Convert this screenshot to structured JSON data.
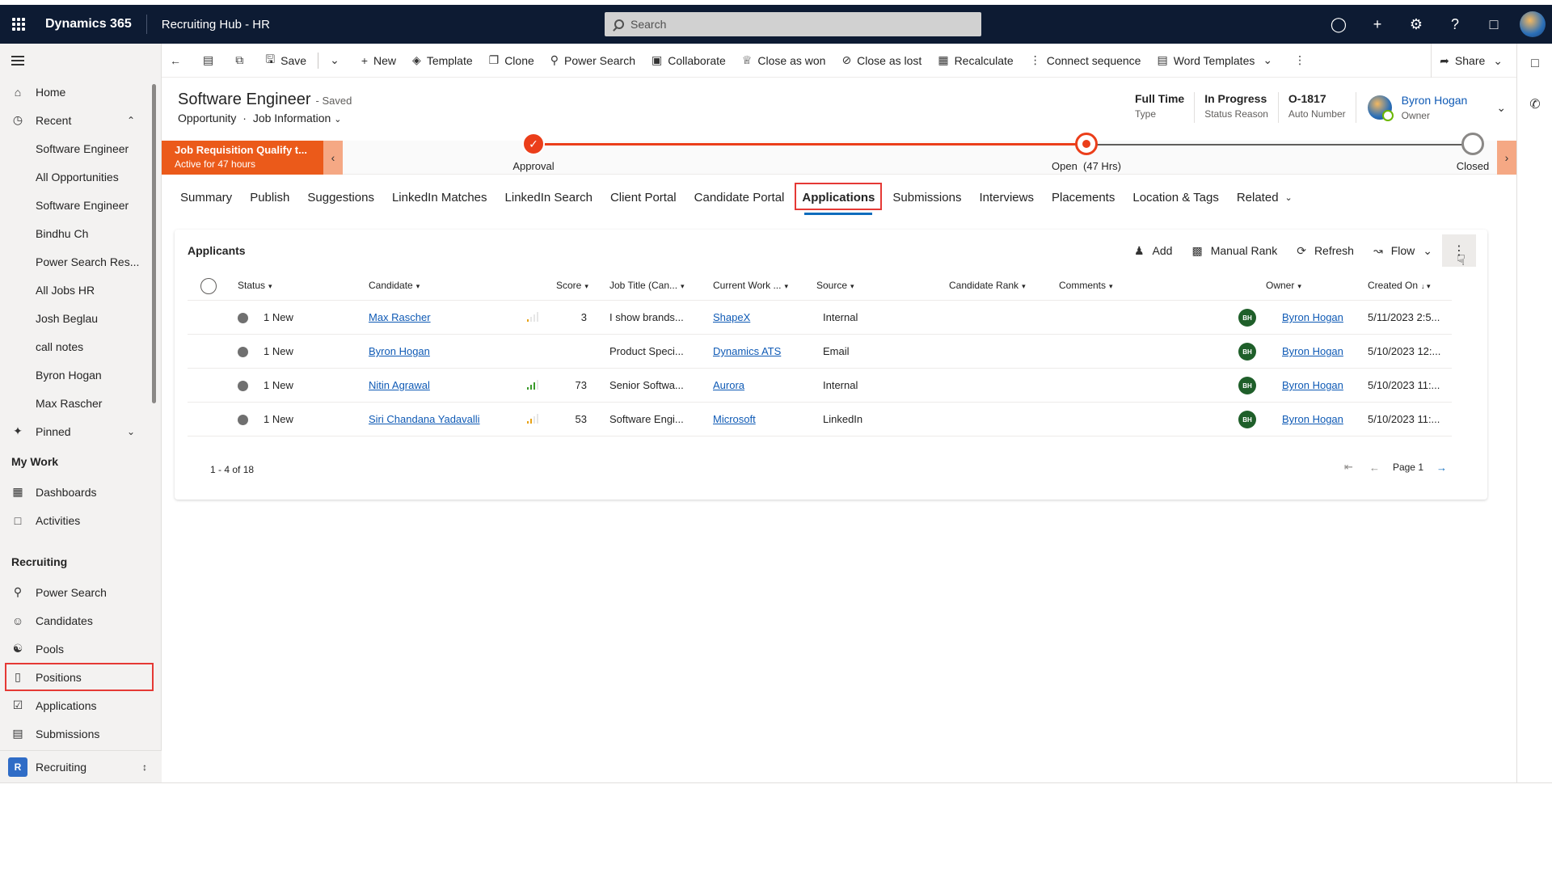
{
  "header": {
    "brand": "Dynamics 365",
    "app_name": "Recruiting Hub - HR",
    "search_placeholder": "Search",
    "icons": [
      "lightbulb-icon",
      "plus-icon",
      "gear-icon",
      "question-icon",
      "chat-icon",
      "avatar"
    ]
  },
  "nav": {
    "home": "Home",
    "recent": "Recent",
    "recent_items": [
      "Software Engineer",
      "All Opportunities",
      "Software Engineer",
      "Bindhu Ch",
      "Power Search Res...",
      "All Jobs HR",
      "Josh Beglau",
      "call notes",
      "Byron Hogan",
      "Max Rascher"
    ],
    "pinned": "Pinned",
    "my_work": "My Work",
    "dashboards": "Dashboards",
    "activities": "Activities",
    "recruiting": "Recruiting",
    "power_search": "Power Search",
    "candidates": "Candidates",
    "pools": "Pools",
    "positions": "Positions",
    "applications": "Applications",
    "submissions": "Submissions",
    "area_badge": "R",
    "area_name": "Recruiting"
  },
  "commands": {
    "save": "Save",
    "new": "New",
    "template": "Template",
    "clone": "Clone",
    "power_search": "Power Search",
    "collaborate": "Collaborate",
    "close_won": "Close as won",
    "close_lost": "Close as lost",
    "recalculate": "Recalculate",
    "connect_sequence": "Connect sequence",
    "word_templates": "Word Templates",
    "share": "Share"
  },
  "form": {
    "title": "Software Engineer",
    "saved": "- Saved",
    "entity": "Opportunity",
    "dot": "·",
    "form_name": "Job Information",
    "fields": [
      {
        "value": "Full Time",
        "label": "Type"
      },
      {
        "value": "In Progress",
        "label": "Status Reason"
      },
      {
        "value": "O-1817",
        "label": "Auto Number"
      }
    ],
    "owner_name": "Byron Hogan",
    "owner_label": "Owner"
  },
  "bpf": {
    "active_title": "Job Requisition Qualify t...",
    "active_sub": "Active for 47 hours",
    "stages": [
      "Approval",
      "Open  (47 Hrs)",
      "Closed"
    ]
  },
  "tabs": [
    "Summary",
    "Publish",
    "Suggestions",
    "LinkedIn Matches",
    "LinkedIn Search",
    "Client Portal",
    "Candidate Portal",
    "Applications",
    "Submissions",
    "Interviews",
    "Placements",
    "Location & Tags",
    "Related"
  ],
  "grid": {
    "title": "Applicants",
    "add": "Add",
    "manual_rank": "Manual Rank",
    "refresh": "Refresh",
    "flow": "Flow",
    "more": "⋮",
    "columns": {
      "status": "Status",
      "candidate": "Candidate",
      "score": "Score",
      "job_title": "Job Title (Can...",
      "current_work": "Current Work ...",
      "source": "Source",
      "candidate_rank": "Candidate Rank",
      "comments": "Comments",
      "owner": "Owner",
      "created_on": "Created On"
    },
    "rows": [
      {
        "status": "1 New",
        "candidate": "Max Rascher",
        "score": "3",
        "score_level": 0.05,
        "job_title": "I show brands...",
        "company": "ShapeX",
        "source": "Internal",
        "owner_initials": "BH",
        "owner": "Byron Hogan",
        "created": "5/11/2023 2:5..."
      },
      {
        "status": "1 New",
        "candidate": "Byron Hogan",
        "score": "",
        "score_level": 0,
        "job_title": "Product Speci...",
        "company": "Dynamics ATS",
        "source": "Email",
        "owner_initials": "BH",
        "owner": "Byron Hogan",
        "created": "5/10/2023 12:..."
      },
      {
        "status": "1 New",
        "candidate": "Nitin Agrawal",
        "score": "73",
        "score_level": 0.73,
        "job_title": "Senior Softwa...",
        "company": "Aurora",
        "source": "Internal",
        "owner_initials": "BH",
        "owner": "Byron Hogan",
        "created": "5/10/2023 11:..."
      },
      {
        "status": "1 New",
        "candidate": "Siri Chandana Yadavalli",
        "score": "53",
        "score_level": 0.53,
        "job_title": "Software Engi...",
        "company": "Microsoft",
        "source": "LinkedIn",
        "owner_initials": "BH",
        "owner": "Byron Hogan",
        "created": "5/10/2023 11:..."
      }
    ],
    "footer": "1 - 4 of 18",
    "page": "Page 1"
  },
  "colors": {
    "header_bg": "#0d1b33",
    "bpf_orange": "#eb5a1a",
    "link": "#0f5ab5",
    "highlight": "#e53935"
  }
}
